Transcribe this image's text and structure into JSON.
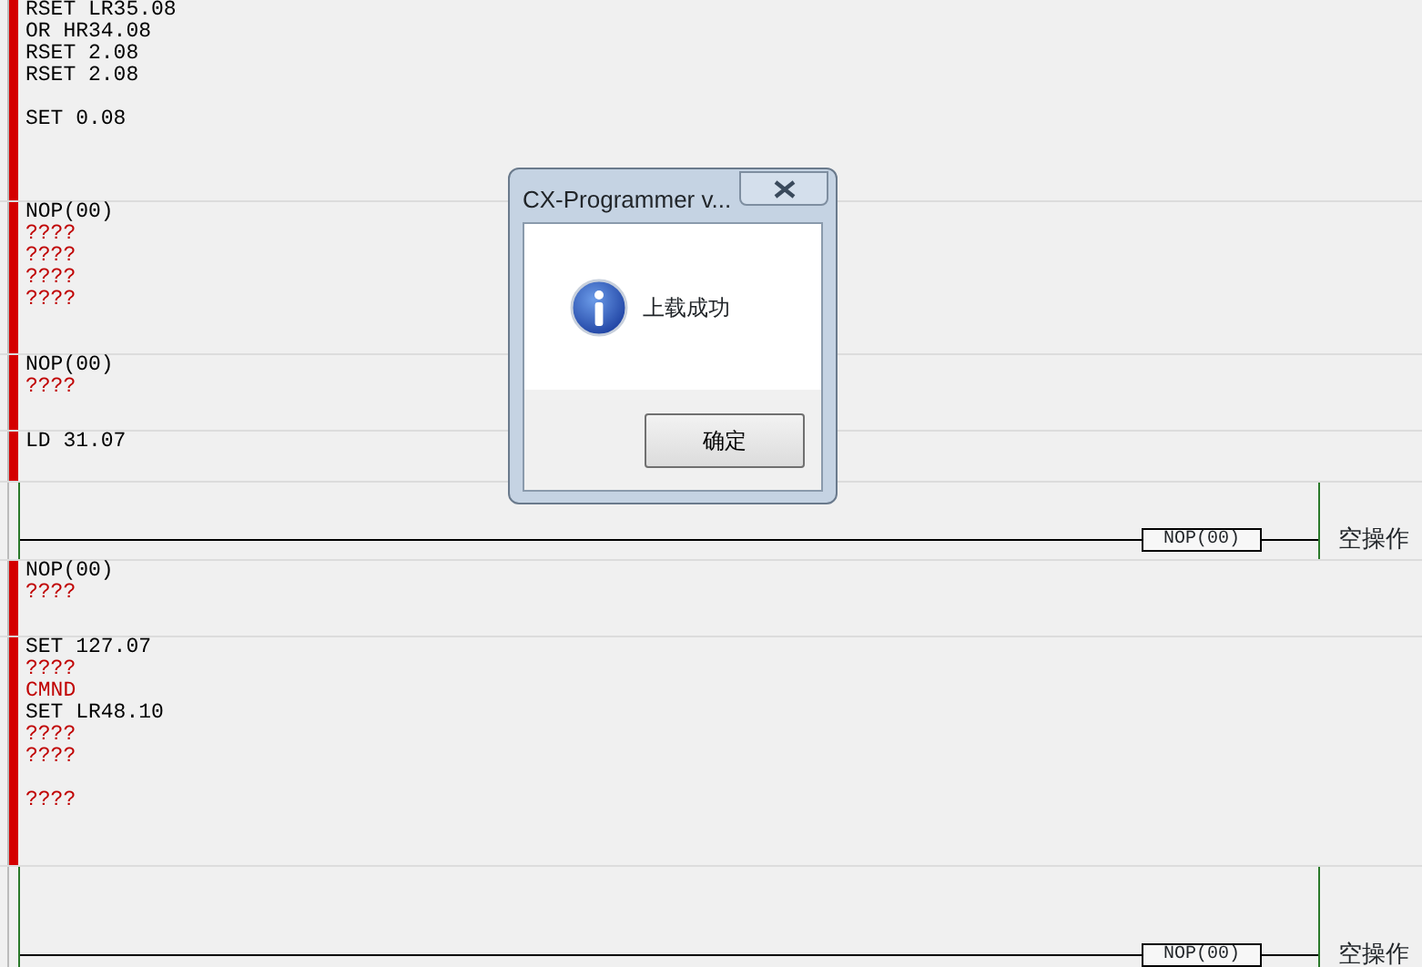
{
  "rungs": [
    {
      "kind": "mnemonic",
      "error": true,
      "lines": [
        {
          "text": "RSET LR35.08",
          "error": false
        },
        {
          "text": "OR HR34.08",
          "error": false
        },
        {
          "text": "RSET 2.08",
          "error": false
        },
        {
          "text": "RSET 2.08",
          "error": false
        },
        {
          "text": "SET 0.08",
          "error": false,
          "spaced": true
        }
      ]
    },
    {
      "kind": "mnemonic",
      "error": true,
      "lines": [
        {
          "text": "NOP(00)",
          "error": false
        },
        {
          "text": "????",
          "error": true
        },
        {
          "text": "????",
          "error": true
        },
        {
          "text": "????",
          "error": true
        },
        {
          "text": "????",
          "error": true
        }
      ]
    },
    {
      "kind": "mnemonic",
      "error": true,
      "lines": [
        {
          "text": "NOP(00)",
          "error": false
        },
        {
          "text": "????",
          "error": true
        }
      ]
    },
    {
      "kind": "mnemonic",
      "error": true,
      "lines": [
        {
          "text": "LD 31.07",
          "error": false
        }
      ]
    },
    {
      "kind": "ladder",
      "error": false,
      "instruction": "NOP(00)",
      "comment": "空操作"
    },
    {
      "kind": "mnemonic",
      "error": true,
      "lines": [
        {
          "text": "NOP(00)",
          "error": false
        },
        {
          "text": "????",
          "error": true
        }
      ]
    },
    {
      "kind": "mnemonic",
      "error": true,
      "lines": [
        {
          "text": "SET 127.07",
          "error": false
        },
        {
          "text": "????",
          "error": true
        },
        {
          "text": "CMND",
          "error": true
        },
        {
          "text": "SET LR48.10",
          "error": false
        },
        {
          "text": "????",
          "error": true
        },
        {
          "text": "????",
          "error": true
        },
        {
          "text": "????",
          "error": true,
          "spaced": true
        }
      ]
    },
    {
      "kind": "ladder",
      "error": false,
      "instruction": "NOP(00)",
      "comment": "空操作"
    }
  ],
  "dialog": {
    "title": "CX-Programmer v...",
    "message": "上载成功",
    "button": "确定"
  }
}
